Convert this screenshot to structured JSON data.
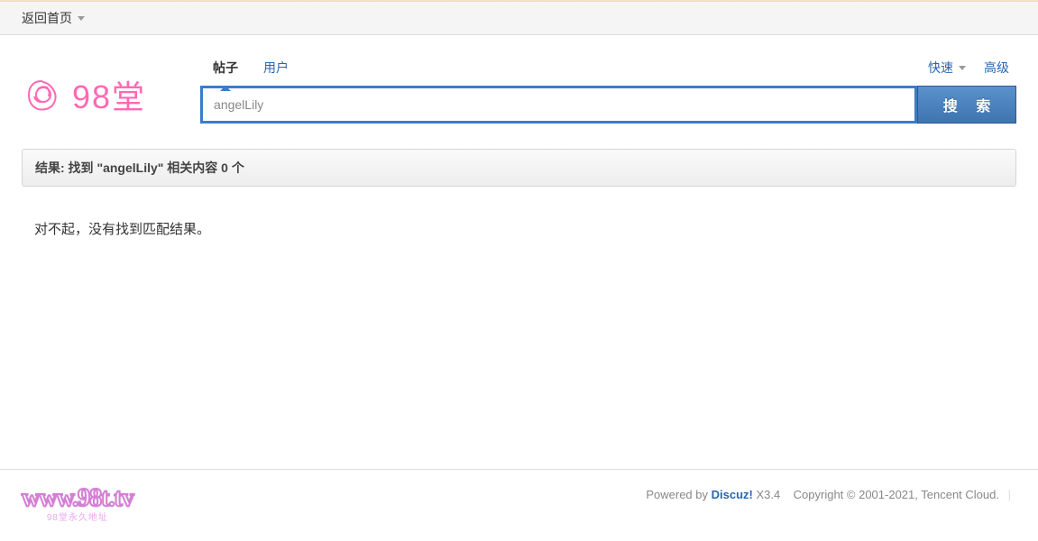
{
  "breadcrumb": {
    "home": "返回首页"
  },
  "logo": {
    "text": "98堂"
  },
  "search": {
    "tabs": {
      "posts": "帖子",
      "users": "用户"
    },
    "quick": "快速",
    "advanced": "高级",
    "value": "angelLily",
    "button": "搜 索"
  },
  "results": {
    "header": "结果: 找到 \"angelLily\" 相关内容 0 个",
    "empty": "对不起，没有找到匹配结果。"
  },
  "footer": {
    "logo": "www.98t.tv",
    "logoSub": "98堂永久地址",
    "powered_prefix": "Powered by ",
    "discuz": "Discuz!",
    "version": " X3.4",
    "copyright": "Copyright © 2001-2021, Tencent Cloud."
  }
}
